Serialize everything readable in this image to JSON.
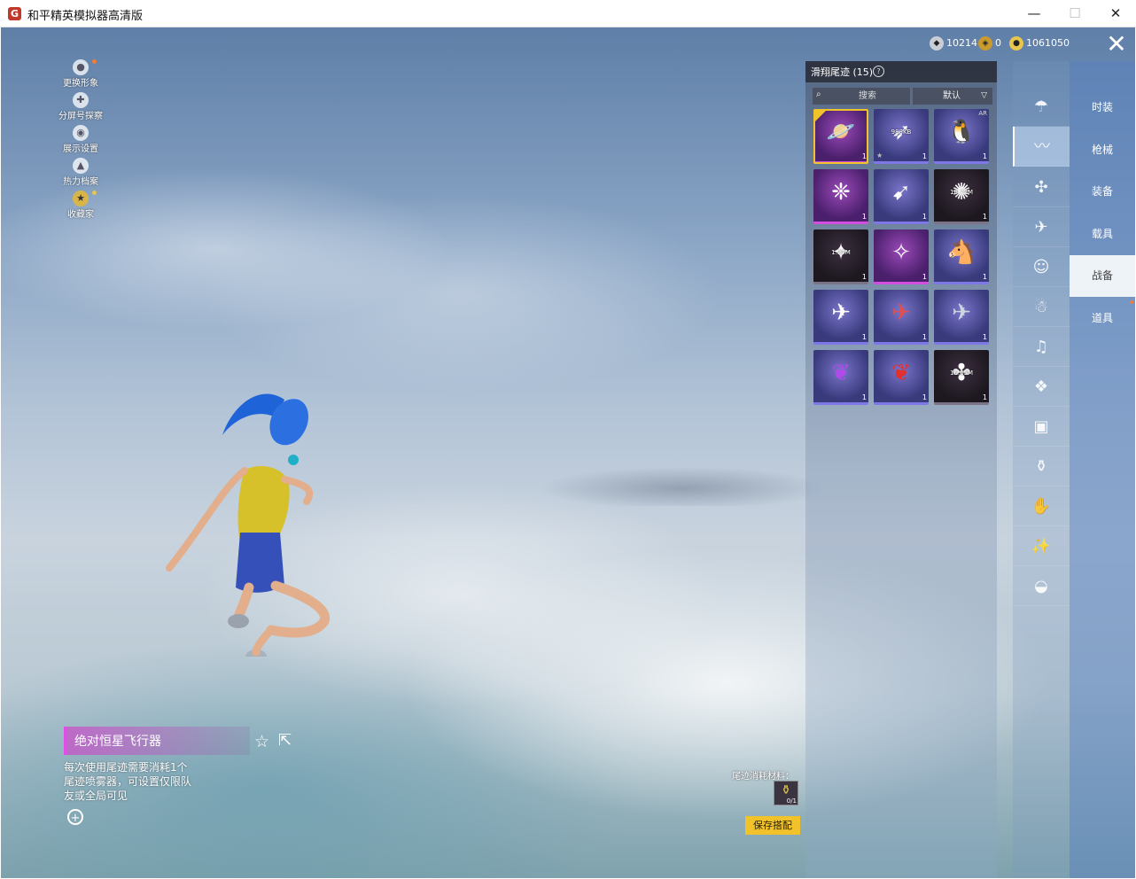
{
  "window": {
    "title": "和平精英模拟器高清版",
    "controls": [
      "—",
      "☐",
      "✕"
    ]
  },
  "left_tools": [
    {
      "label": "更换形象",
      "icon": "avatar-icon",
      "dot": true
    },
    {
      "label": "分屏号探察",
      "icon": "gamepad-icon",
      "dot": false
    },
    {
      "label": "展示设置",
      "icon": "eye-icon",
      "dot": false
    },
    {
      "label": "热力档案",
      "icon": "flame-icon",
      "dot": false
    },
    {
      "label": "收藏家",
      "icon": "collector-badge-icon",
      "dot": true
    }
  ],
  "currency": [
    {
      "value": "10214",
      "icon": "silver-coin-icon"
    },
    {
      "value": "0",
      "icon": "gold-token-icon"
    },
    {
      "value": "1061050",
      "icon": "gold-coin-icon"
    }
  ],
  "panel": {
    "title": "滑翔尾迹 (15)",
    "search_placeholder": "搜索",
    "sort_label": "默认"
  },
  "items": [
    {
      "style": "purple",
      "icon": "planet-trail-icon",
      "count": "1",
      "selected": true
    },
    {
      "style": "violet",
      "icon": "rocket-trail-icon",
      "count": "1",
      "download": "988KB",
      "star": true
    },
    {
      "style": "violet",
      "icon": "penguin-trail-icon",
      "count": "1",
      "badge": "AR"
    },
    {
      "style": "purple",
      "icon": "crystal-trail-icon",
      "count": "1"
    },
    {
      "style": "violet",
      "icon": "wing-blade-trail-icon",
      "count": "1"
    },
    {
      "style": "dark",
      "icon": "dark-creature-trail-icon",
      "count": "1",
      "download": "18.72M"
    },
    {
      "style": "dark",
      "icon": "bat-trail-icon",
      "count": "1",
      "download": "1.33M"
    },
    {
      "style": "purple",
      "icon": "dragonfly-trail-icon",
      "count": "1"
    },
    {
      "style": "violet",
      "icon": "horse-toy-trail-icon",
      "count": "1"
    },
    {
      "style": "violet",
      "icon": "golden-jet-trail-icon",
      "count": "1"
    },
    {
      "style": "violet",
      "icon": "red-jet-trail-icon",
      "count": "1"
    },
    {
      "style": "violet",
      "icon": "shark-jet-trail-icon",
      "count": "1"
    },
    {
      "style": "violet",
      "icon": "purple-smoke-trail-icon",
      "count": "1"
    },
    {
      "style": "violet",
      "icon": "red-smoke-trail-icon",
      "count": "1"
    },
    {
      "style": "dark",
      "icon": "eagle-trail-icon",
      "count": "1",
      "download": "16.65M"
    }
  ],
  "selected_item": {
    "name": "绝对恒星飞行器",
    "description": "每次使用尾迹需要消耗1个尾迹喷雾器，可设置仅限队友或全局可见"
  },
  "consume": {
    "label": "尾迹消耗材料：",
    "count": "0/1"
  },
  "save_button": "保存搭配",
  "sub_categories": [
    {
      "icon": "parachute-icon"
    },
    {
      "icon": "glide-trail-icon",
      "active": true
    },
    {
      "icon": "drone-icon"
    },
    {
      "icon": "plane-icon"
    },
    {
      "icon": "emote-icon"
    },
    {
      "icon": "robot-icon"
    },
    {
      "icon": "speaker-icon"
    },
    {
      "icon": "pet-icon"
    },
    {
      "icon": "gallery-icon"
    },
    {
      "icon": "spray-can-icon"
    },
    {
      "icon": "gesture-icon"
    },
    {
      "icon": "magic-wand-icon"
    },
    {
      "icon": "ufo-icon"
    }
  ],
  "main_categories": [
    {
      "label": "时装"
    },
    {
      "label": "枪械"
    },
    {
      "label": "装备"
    },
    {
      "label": "载具"
    },
    {
      "label": "战备",
      "active": true
    },
    {
      "label": "道具"
    }
  ]
}
